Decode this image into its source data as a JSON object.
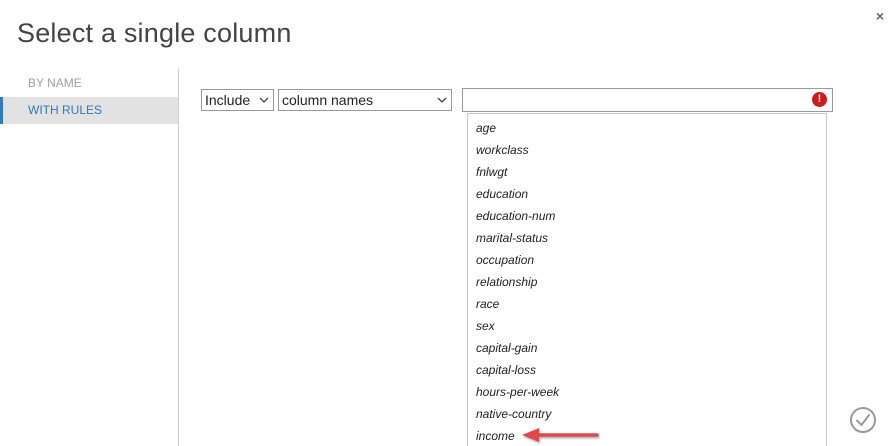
{
  "dialog": {
    "title": "Select a single column",
    "close_glyph": "×"
  },
  "sidebar": {
    "items": [
      {
        "label": "BY NAME",
        "active": false
      },
      {
        "label": "WITH RULES",
        "active": true
      }
    ]
  },
  "rule": {
    "mode_value": "Include",
    "type_value": "column names",
    "text_value": "",
    "error_glyph": "!"
  },
  "dropdown": {
    "options": [
      "age",
      "workclass",
      "fnlwgt",
      "education",
      "education-num",
      "marital-status",
      "occupation",
      "relationship",
      "race",
      "sex",
      "capital-gain",
      "capital-loss",
      "hours-per-week",
      "native-country",
      "income"
    ]
  },
  "colors": {
    "accent": "#2e7bc0",
    "error": "#d11a1a",
    "arrow": "#e04848"
  },
  "icons": {
    "close": "close-icon",
    "error": "error-icon",
    "ok": "checkmark-icon",
    "arrow": "annotation-arrow-icon"
  }
}
